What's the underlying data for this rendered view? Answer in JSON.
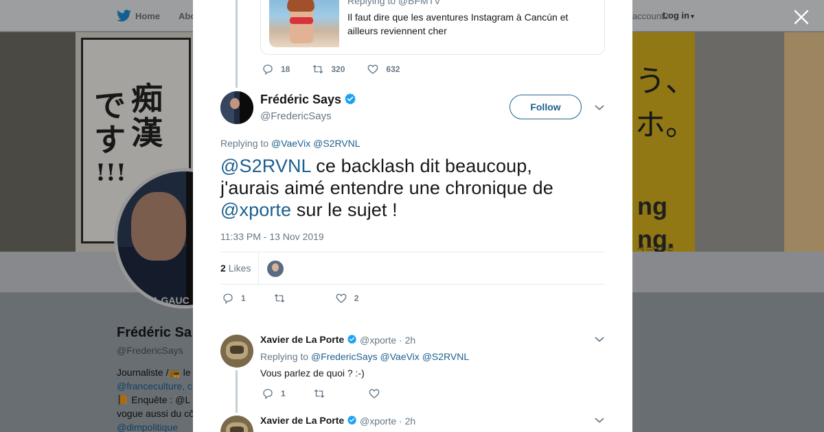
{
  "background": {
    "topbar": {
      "home": "Home",
      "about": "Abo",
      "account_question": "account?",
      "login": "Log in"
    },
    "banner": {
      "jp_left_1": "痴",
      "jp_left_2": "漢",
      "jp_left_3": "で",
      "jp_left_4": "す",
      "jp_left_5": "!!!",
      "jp_right_1": "う、",
      "jp_right_2": "ホ。",
      "ad_1": "ng",
      "ad_2": "ng.",
      "gauche": "A GAUC",
      "ko": "서 스마트폰"
    },
    "profile": {
      "name": "Frédéric Sa",
      "handle": "@FredericSays",
      "bio_1": "Journaliste /📻 le",
      "bio_2": "@franceculture, c",
      "bio_3": "📙 Enquête : @L",
      "bio_4": "vogue aussi du cô",
      "bio_5": "@dimpolitique"
    }
  },
  "quoted_tweet": {
    "replying": "Replying to @BFMTV",
    "text": "Il faut dire que les aventures Instagram à Cancún et ailleurs reviennent cher",
    "replies": "18",
    "retweets": "320",
    "likes": "632"
  },
  "main_tweet": {
    "name": "Frédéric Says",
    "handle": "@FredericSays",
    "follow_label": "Follow",
    "replying_prefix": "Replying to",
    "replying_1": "@VaeVix",
    "replying_2": "@S2RVNL",
    "text_mention_1": "@S2RVNL",
    "text_1": " ce backlash dit beaucoup, j'aurais aimé entendre une chronique de ",
    "text_mention_2": "@xporte",
    "text_2": " sur le sujet !",
    "timestamp": "11:33 PM - 13 Nov 2019",
    "likes_count": "2",
    "likes_label": "Likes",
    "replies": "1",
    "retweets": "",
    "likes": "2"
  },
  "replies": [
    {
      "name": "Xavier de La Porte",
      "handle": "@xporte",
      "time": "· 2h",
      "replying_prefix": "Replying to",
      "replying_1": "@FredericSays",
      "replying_2": "@VaeVix",
      "replying_3": "@S2RVNL",
      "text": "Vous parlez de quoi ? :-)",
      "replies": "1",
      "retweets": "",
      "likes": ""
    },
    {
      "name": "Xavier de La Porte",
      "handle": "@xporte",
      "time": "· 2h"
    }
  ],
  "colors": {
    "link": "#1b5f8f",
    "verified": "#1da1f2",
    "muted": "#657786"
  },
  "icons": [
    "twitter-bird-icon",
    "close-icon",
    "reply-icon",
    "retweet-icon",
    "like-icon",
    "verified-icon",
    "chevron-down-icon"
  ]
}
